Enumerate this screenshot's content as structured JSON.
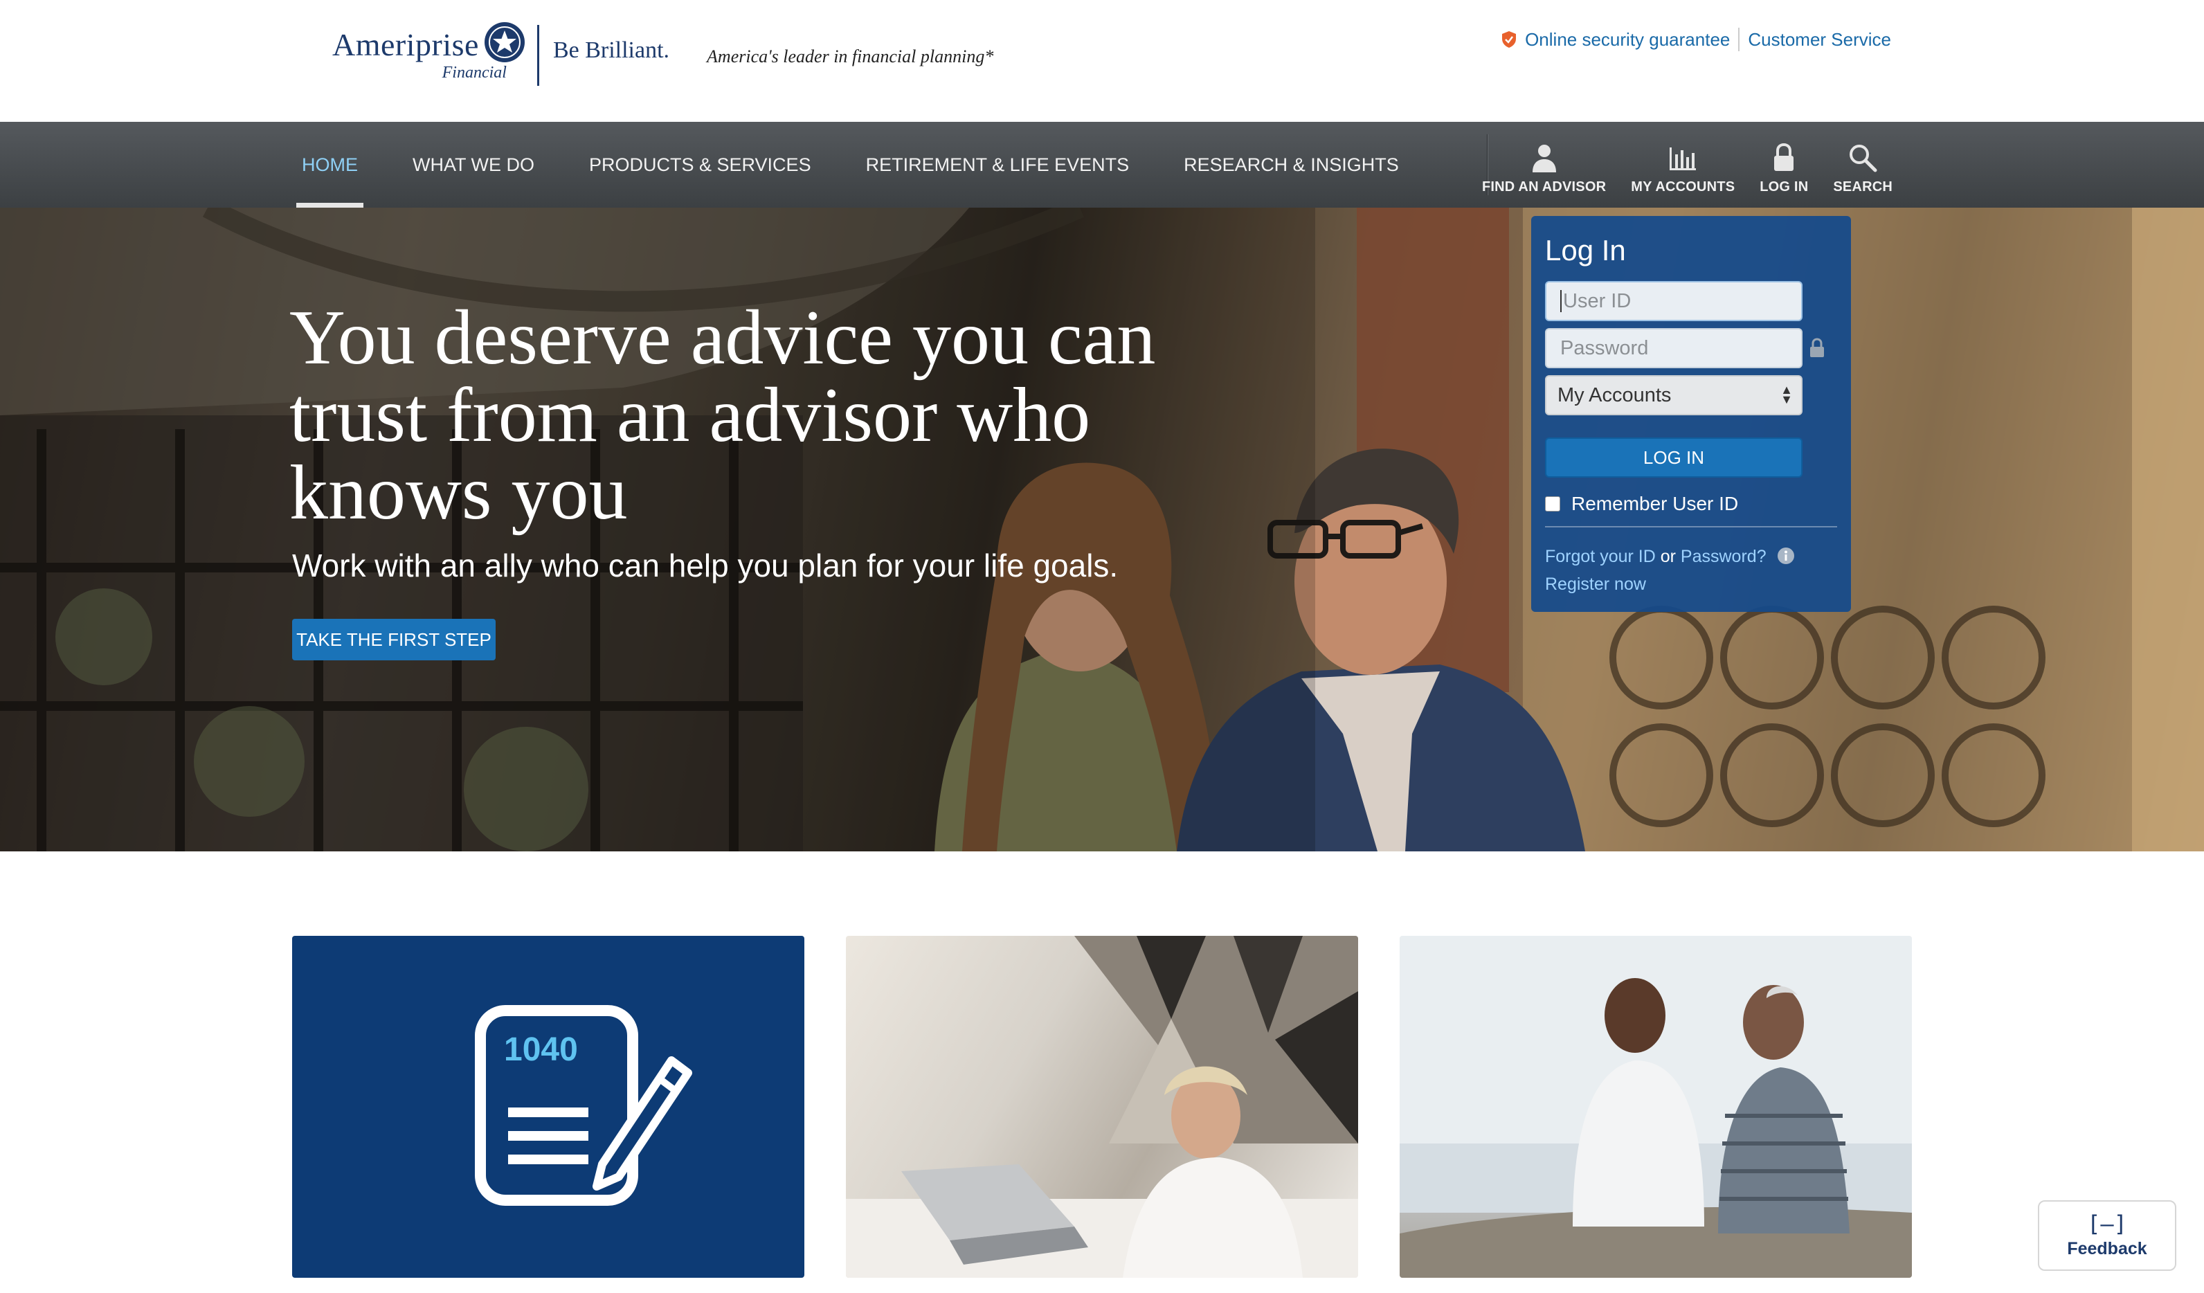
{
  "header": {
    "logo_name": "Ameriprise",
    "logo_sub": "Financial",
    "logo_slogan": "Be Brilliant.",
    "tagline": "America's leader in financial planning*",
    "security_link": "Online security guarantee",
    "customer_service_link": "Customer Service"
  },
  "nav": {
    "items": [
      {
        "label": "HOME"
      },
      {
        "label": "WHAT WE DO"
      },
      {
        "label": "PRODUCTS & SERVICES"
      },
      {
        "label": "RETIREMENT & LIFE EVENTS"
      },
      {
        "label": "RESEARCH & INSIGHTS"
      }
    ],
    "tools": [
      {
        "label": "FIND AN ADVISOR",
        "icon": "person-icon"
      },
      {
        "label": "MY ACCOUNTS",
        "icon": "bar-chart-icon"
      },
      {
        "label": "LOG IN",
        "icon": "lock-icon"
      },
      {
        "label": "SEARCH",
        "icon": "search-icon"
      }
    ]
  },
  "hero": {
    "title": "You deserve advice you can trust from an advisor who knows you",
    "subtitle": "Work with an ally who can help you plan for your life goals.",
    "cta": "TAKE THE FIRST STEP"
  },
  "login": {
    "title": "Log In",
    "userid_placeholder": "User ID",
    "password_placeholder": "Password",
    "account_type": "My Accounts",
    "button": "LOG IN",
    "remember": "Remember User ID",
    "forgot_prefix": "Forgot your ID",
    "or": "or",
    "password_link": "Password?",
    "register": "Register now"
  },
  "cards": {
    "card1_form_number": "1040"
  },
  "feedback": {
    "icon": "[–]",
    "label": "Feedback"
  },
  "colors": {
    "brand_navy": "#1d3a6b",
    "link_blue": "#1a6aa8",
    "cta_blue": "#1a73b8",
    "nav_active": "#8fd0f5",
    "security_orange": "#e8612c"
  }
}
